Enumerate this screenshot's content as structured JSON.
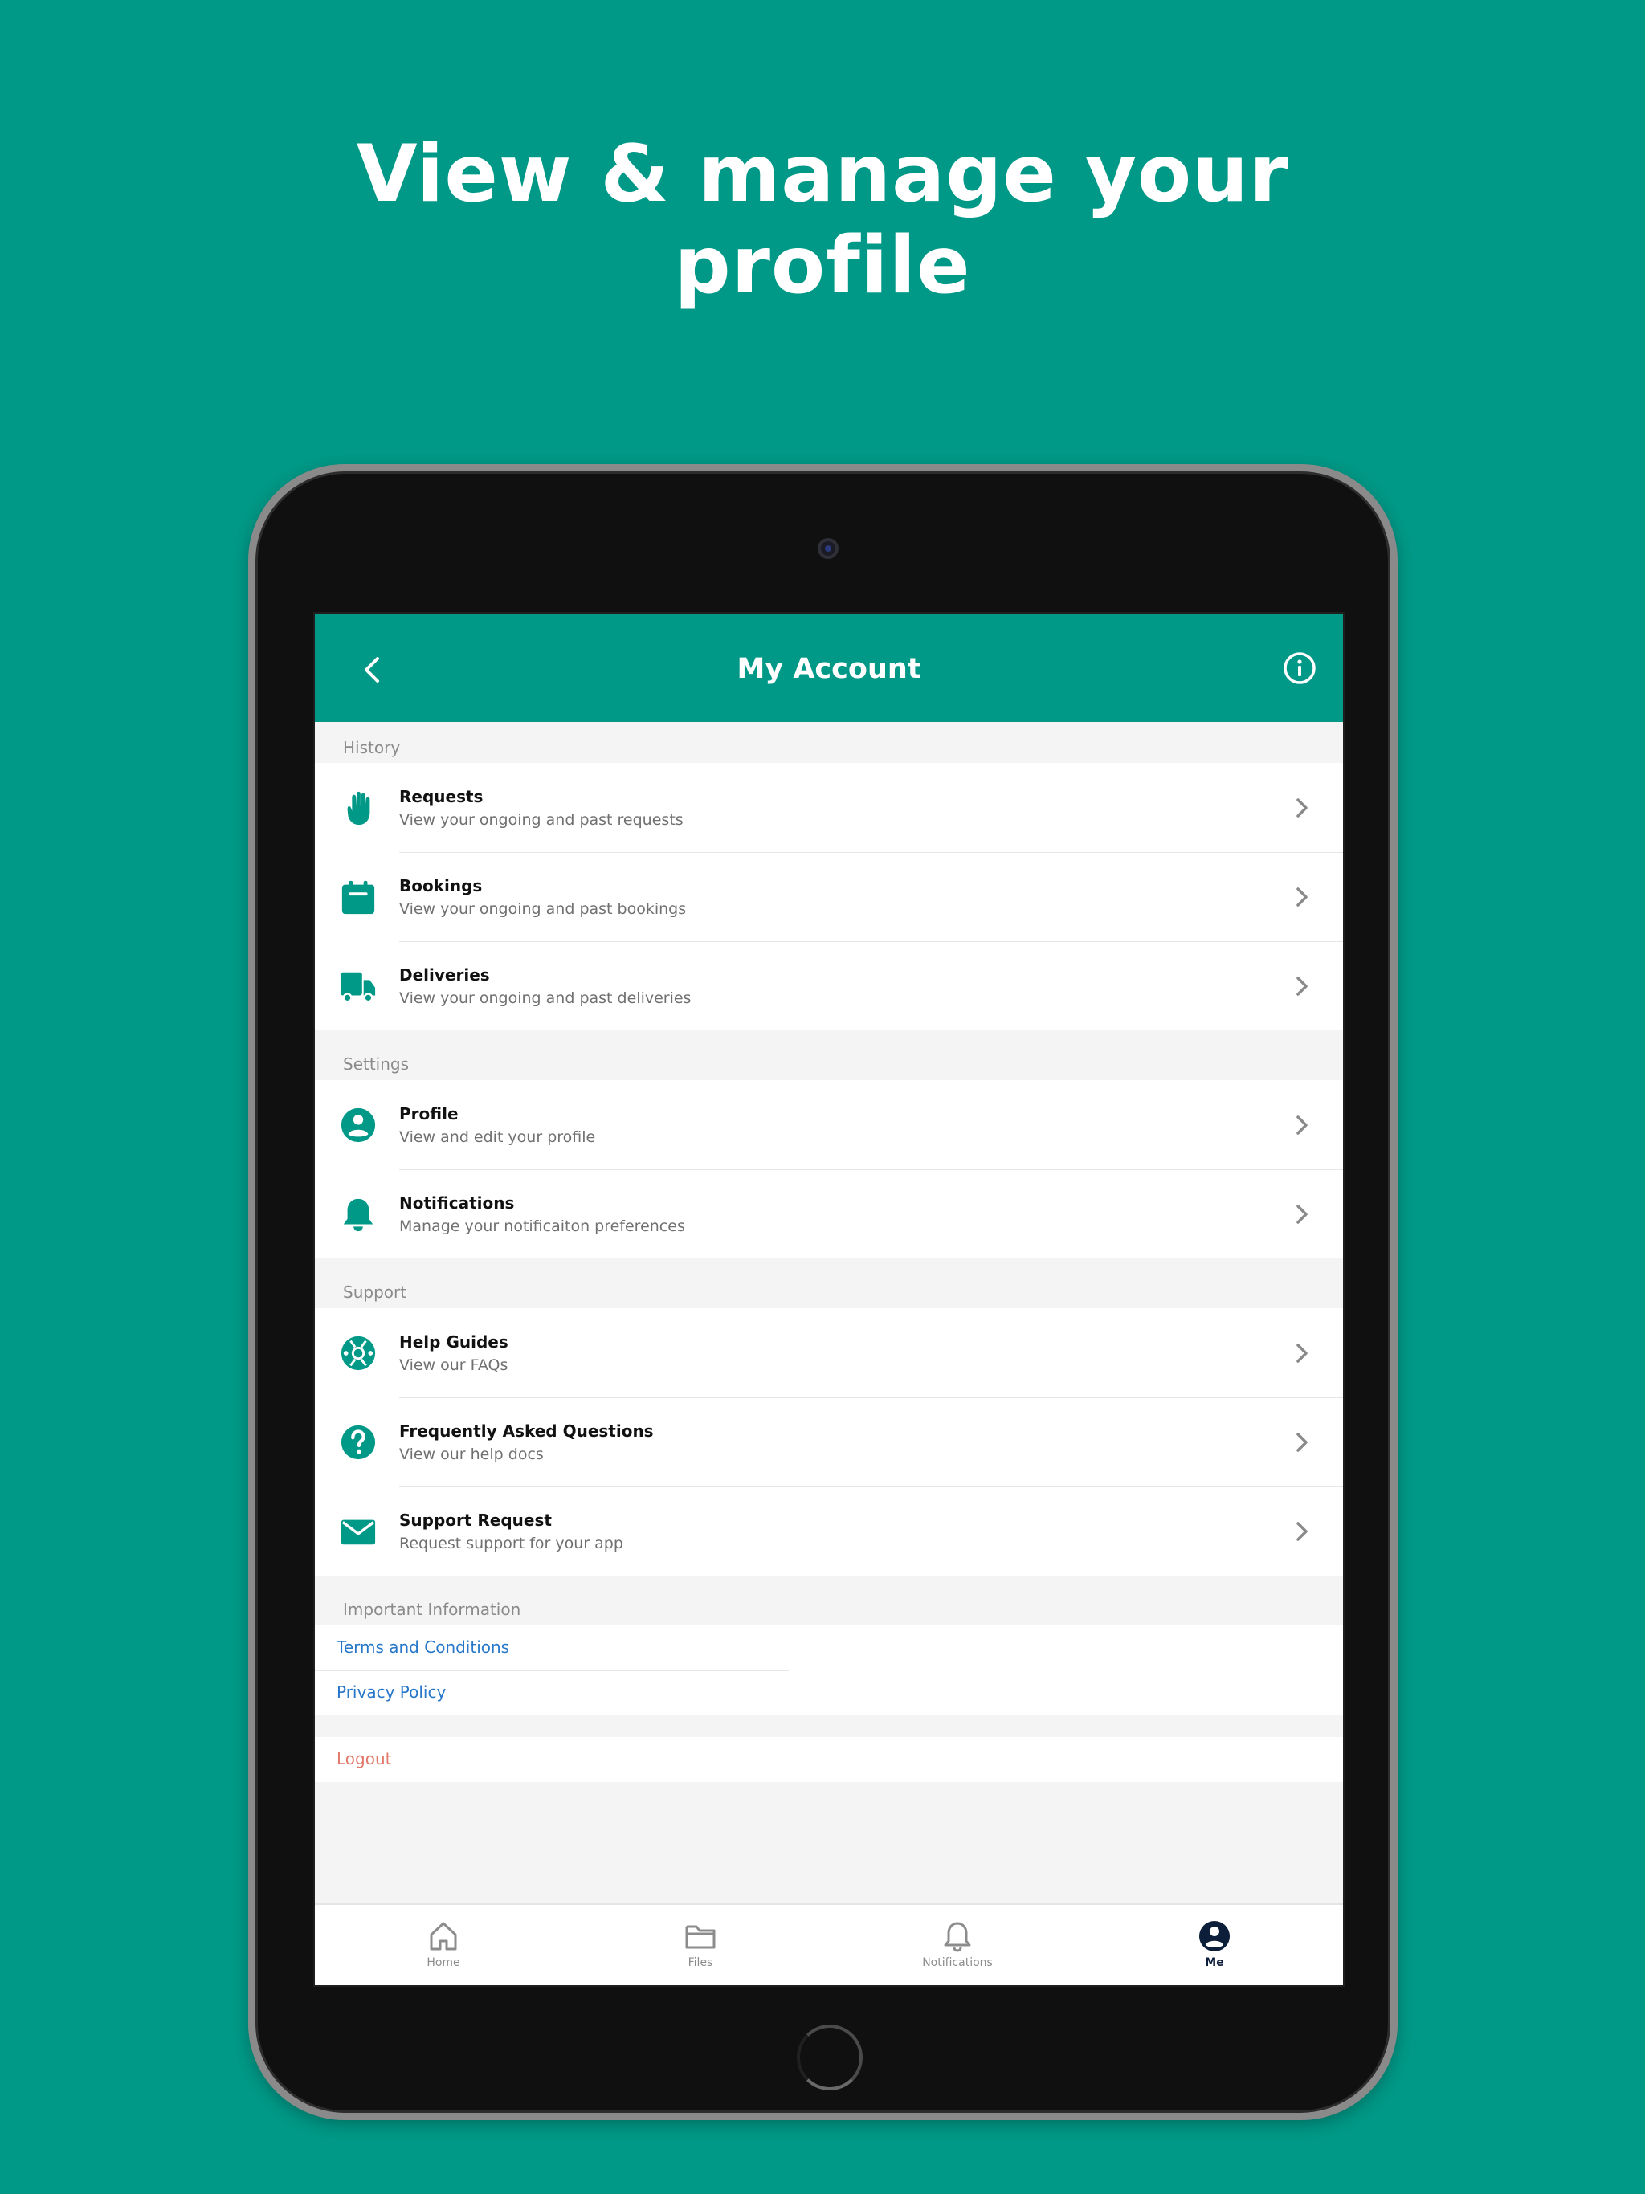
{
  "headline": {
    "line1": "View & manage your",
    "line2": "profile"
  },
  "app": {
    "title": "My Account"
  },
  "sections": {
    "history": {
      "label": "History",
      "items": [
        {
          "title": "Requests",
          "subtitle": "View your ongoing and past requests",
          "icon": "raised-hand-icon"
        },
        {
          "title": "Bookings",
          "subtitle": "View your ongoing and past bookings",
          "icon": "calendar-icon"
        },
        {
          "title": "Deliveries",
          "subtitle": "View your ongoing and past deliveries",
          "icon": "truck-icon"
        }
      ]
    },
    "settings": {
      "label": "Settings",
      "items": [
        {
          "title": "Profile",
          "subtitle": "View and edit your profile",
          "icon": "user-circle-icon"
        },
        {
          "title": "Notifications",
          "subtitle": "Manage your notificaiton preferences",
          "icon": "bell-icon"
        }
      ]
    },
    "support": {
      "label": "Support",
      "items": [
        {
          "title": "Help Guides",
          "subtitle": "View our FAQs",
          "icon": "lifebuoy-icon"
        },
        {
          "title": "Frequently Asked Questions",
          "subtitle": "View our help docs",
          "icon": "question-circle-icon"
        },
        {
          "title": "Support Request",
          "subtitle": "Request support for your app",
          "icon": "envelope-icon"
        }
      ]
    },
    "important": {
      "label": "Important Information",
      "links": [
        "Terms and Conditions",
        "Privacy Policy"
      ]
    },
    "logout": "Logout"
  },
  "tabbar": {
    "tabs": [
      {
        "label": "Home",
        "icon": "home-icon",
        "active": false
      },
      {
        "label": "Files",
        "icon": "folder-icon",
        "active": false
      },
      {
        "label": "Notifications",
        "icon": "bell-icon",
        "active": false
      },
      {
        "label": "Me",
        "icon": "user-circle-icon",
        "active": true
      }
    ]
  },
  "colors": {
    "brand": "#009886",
    "link": "#2677c9",
    "logout": "#e0796a",
    "active_tab": "#0d1e3a"
  }
}
